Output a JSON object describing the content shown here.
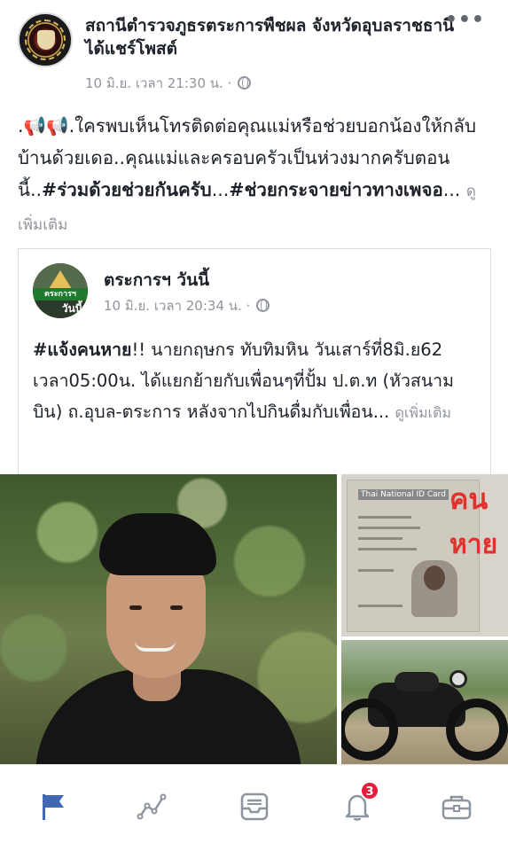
{
  "post": {
    "page_name": "สถานีตำรวจภูธรตระการพืชผล จังหวัดอุบลราชธานี",
    "shared_label": "ได้แชร์โพสต์",
    "timestamp": "10 มิ.ย. เวลา 21:30 น. ·",
    "more_label": "•••",
    "text_prefix": ".📢📢.ใครพบเห็นโทรติดต่อคุณแม่หรือช่วยบอกน้องให้กลับบ้านด้วยเดอ..คุณแม่และครอบครัวเป็นห่วงมากครับตอนนี้..",
    "tag1": "#ร่วมด้วยช่วยกันครับ",
    "text_mid": "...",
    "tag2": "#ช่วยกระจายข่าวทางเพจอ",
    "text_ellipsis": "...",
    "see_more": "ดูเพิ่มเติม"
  },
  "shared": {
    "page_name": "ตระการฯ วันนี้",
    "avatar_text_top": "ตระการฯ",
    "avatar_text_bottom": "วันนี้",
    "timestamp": "10 มิ.ย. เวลา 20:34 น. ·",
    "tag": "#แจ้งคนหาย",
    "text": "!! นายกฤษกร ทับทิมหิน วันเสาร์ที่8มิ.ย62 เวลา05:00น. ได้แยกย้ายกับเพื่อนๆที่ปั้ม ป.ต.ท (หัวสนามบิน) ถ.อุบล-ตระการ หลังจากไปกินดื่มกับเพื่อน...",
    "see_more": "ดูเพิ่มเติม"
  },
  "photos": {
    "id_card_title": "Thai National ID Card",
    "overlay_line1": "คน",
    "overlay_line2": "หาย"
  },
  "nav": {
    "notification_count": "3",
    "items": [
      "flag-icon",
      "activity-icon",
      "inbox-icon",
      "bell-icon",
      "briefcase-icon"
    ],
    "active_color": "#4267b2",
    "inactive_color": "#8d949e"
  }
}
